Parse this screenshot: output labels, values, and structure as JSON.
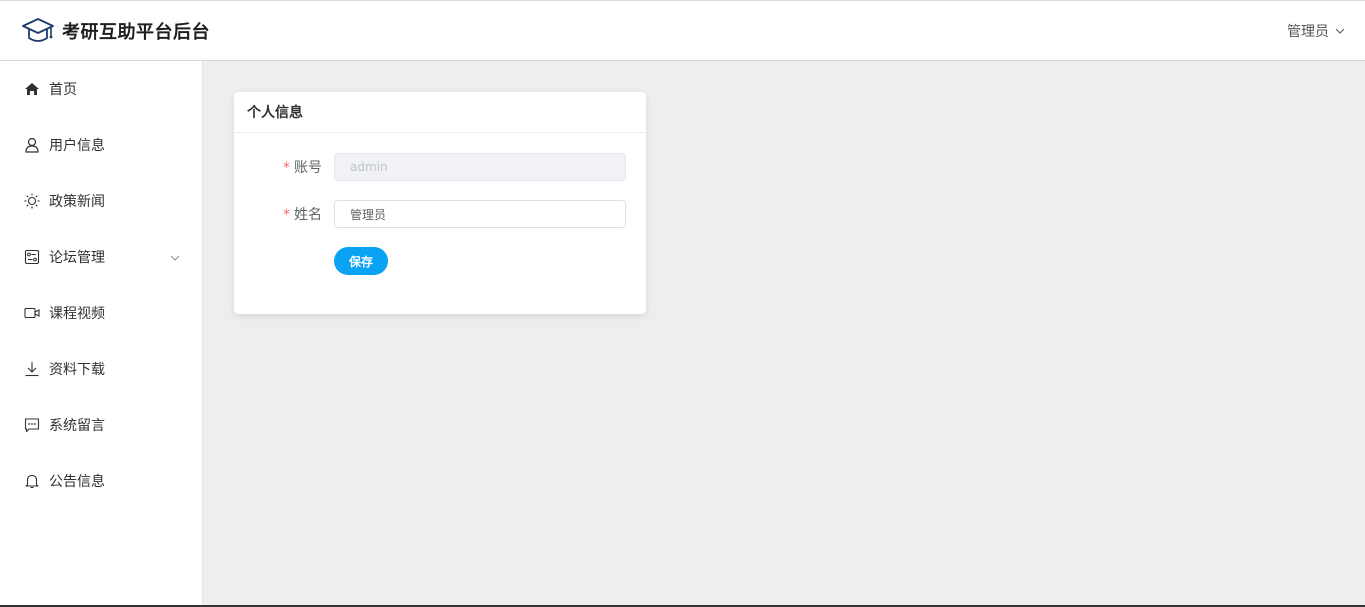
{
  "header": {
    "title": "考研互助平台后台",
    "user_label": "管理员",
    "logo_icon": "graduation-cap-icon"
  },
  "sidebar": {
    "items": [
      {
        "label": "首页",
        "icon": "home-icon"
      },
      {
        "label": "用户信息",
        "icon": "user-icon"
      },
      {
        "label": "政策新闻",
        "icon": "sun-icon"
      },
      {
        "label": "论坛管理",
        "icon": "forum-icon",
        "has_submenu": true
      },
      {
        "label": "课程视频",
        "icon": "video-camera-icon"
      },
      {
        "label": "资料下载",
        "icon": "download-icon"
      },
      {
        "label": "系统留言",
        "icon": "chat-bubble-icon"
      },
      {
        "label": "公告信息",
        "icon": "bell-icon"
      }
    ]
  },
  "profile_card": {
    "title": "个人信息",
    "account_label": "账号",
    "account_value": "admin",
    "name_label": "姓名",
    "name_value": "管理员",
    "required_mark": "*",
    "save_label": "保存"
  },
  "colors": {
    "accent": "#0aa3f4",
    "required": "#f56c6c",
    "background": "#eeeeee"
  }
}
